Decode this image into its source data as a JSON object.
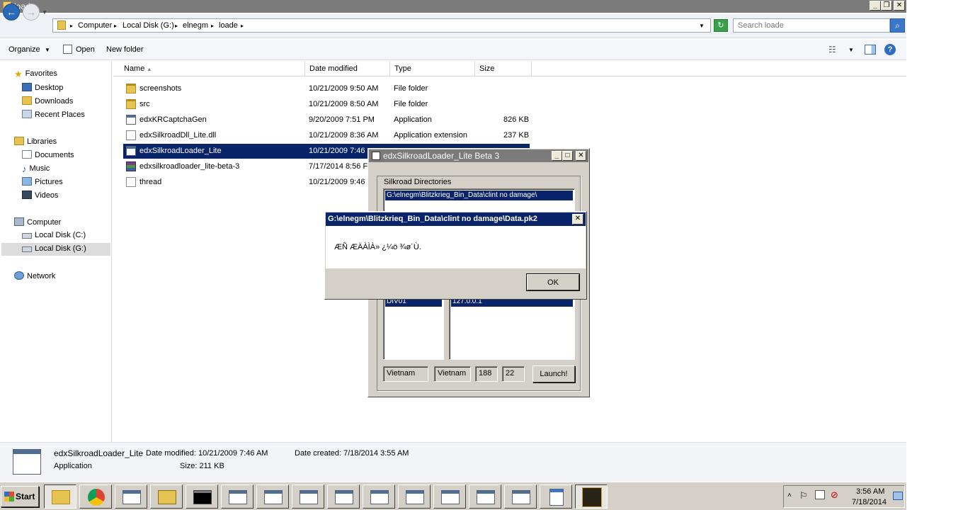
{
  "window": {
    "title": "loade"
  },
  "address": {
    "crumbs": [
      "Computer",
      "Local Disk (G:)",
      "elnegm",
      "loade"
    ],
    "search_placeholder": "Search loade"
  },
  "toolbar": {
    "organize": "Organize",
    "open": "Open",
    "new_folder": "New folder"
  },
  "nav": {
    "favorites": "Favorites",
    "desktop": "Desktop",
    "downloads": "Downloads",
    "recent": "Recent Places",
    "libraries": "Libraries",
    "documents": "Documents",
    "music": "Music",
    "pictures": "Pictures",
    "videos": "Videos",
    "computer": "Computer",
    "local_c": "Local Disk (C:)",
    "local_g": "Local Disk (G:)",
    "network": "Network"
  },
  "columns": {
    "name": "Name",
    "date": "Date modified",
    "type": "Type",
    "size": "Size"
  },
  "files": [
    {
      "name": "screenshots",
      "date": "10/21/2009 9:50 AM",
      "type": "File folder",
      "size": "",
      "icon": "folder-icon"
    },
    {
      "name": "src",
      "date": "10/21/2009 8:50 AM",
      "type": "File folder",
      "size": "",
      "icon": "folder-icon"
    },
    {
      "name": "edxKRCaptchaGen",
      "date": "9/20/2009 7:51 PM",
      "type": "Application",
      "size": "826 KB",
      "icon": "application-icon"
    },
    {
      "name": "edxSilkroadDll_Lite.dll",
      "date": "10/21/2009 8:36 AM",
      "type": "Application extension",
      "size": "237 KB",
      "icon": "dll-icon"
    },
    {
      "name": "edxSilkroadLoader_Lite",
      "date": "10/21/2009 7:46",
      "type": "",
      "size": "",
      "icon": "application-icon"
    },
    {
      "name": "edxsilkroadloader_lite-beta-3",
      "date": "7/17/2014 8:56 F",
      "type": "",
      "size": "",
      "icon": "rar-archive-icon"
    },
    {
      "name": "thread",
      "date": "10/21/2009 9:46",
      "type": "",
      "size": "",
      "icon": "text-file-icon"
    }
  ],
  "details": {
    "name": "edxSilkroadLoader_Lite",
    "type": "Application",
    "date_modified": "Date modified: 10/21/2009 7:46 AM",
    "date_created": "Date created: 7/18/2014 3:55 AM",
    "size": "Size: 211 KB"
  },
  "loader": {
    "title": "edxSilkroadLoader_Lite Beta 3",
    "group_label": "Silkroad Directories",
    "directory": "G:\\elnegm\\Blitzkrieg_Bin_Data\\clint no damage\\",
    "division": "DIV01",
    "ip": "127.0.0.1",
    "locale": "Vietnam",
    "language": "Vietnam",
    "version": "188",
    "locale_id": "22",
    "launch": "Launch!"
  },
  "msgbox": {
    "title": "G:\\elnegm\\Blitzkrieq_Bin_Data\\clint no damage\\Data.pk2",
    "message": "ÆÑ ÆÄÀÌÀ» ¿­¼ö ¾ø´Ù.",
    "ok": "OK"
  },
  "taskbar": {
    "start": "Start"
  },
  "tray": {
    "time": "3:56 AM",
    "date": "7/18/2014"
  }
}
